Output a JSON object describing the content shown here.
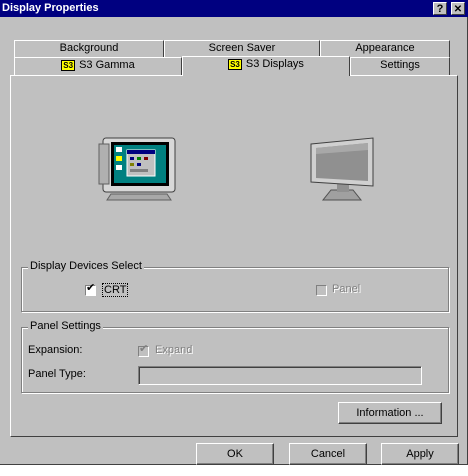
{
  "window": {
    "title": "Display Properties",
    "help_label": "?",
    "close_label": "✕"
  },
  "tabs": {
    "background": "Background",
    "screen_saver": "Screen Saver",
    "appearance": "Appearance",
    "s3_gamma": "S3 Gamma",
    "s3_displays": "S3 Displays",
    "settings": "Settings",
    "s3_badge": "S3",
    "active": "S3 Displays"
  },
  "monitors": {
    "crt_icon": "crt-monitor-icon",
    "panel_icon": "flat-panel-monitor-icon"
  },
  "display_devices": {
    "title": "Display Devices Select",
    "crt_label": "CRT",
    "crt_checked": true,
    "panel_label": "Panel",
    "panel_checked": false,
    "panel_enabled": false
  },
  "panel_settings": {
    "title": "Panel Settings",
    "expansion_label": "Expansion:",
    "expand_label": "Expand",
    "expand_checked": true,
    "expand_enabled": false,
    "panel_type_label": "Panel Type:",
    "panel_type_value": ""
  },
  "buttons": {
    "information": "Information ...",
    "ok": "OK",
    "cancel": "Cancel",
    "apply": "Apply"
  },
  "colors": {
    "titlebar": "#000080",
    "face": "#c0c0c0",
    "s3_badge": "#ffff00"
  }
}
